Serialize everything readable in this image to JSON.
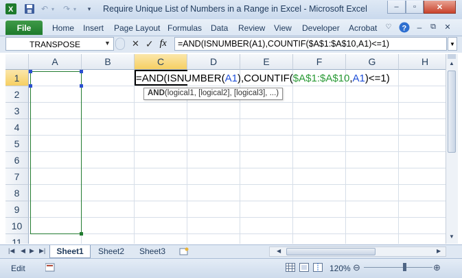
{
  "window": {
    "title": "Require Unique List of Numbers in a Range in Excel  -  Microsoft Excel",
    "controls": {
      "minimize": "–",
      "restore": "▫",
      "close": "✕"
    }
  },
  "quick_access": {
    "app_icon": "excel-logo-icon",
    "save_icon": "save-icon",
    "undo_icon": "undo-icon",
    "redo_icon": "redo-icon"
  },
  "ribbon": {
    "file_tab": "File",
    "tabs": [
      "Home",
      "Insert",
      "Page Layout",
      "Formulas",
      "Data",
      "Review",
      "View",
      "Developer",
      "Acrobat"
    ],
    "help_icon": "?"
  },
  "formula_bar": {
    "name_box": "TRANSPOSE",
    "cancel_icon": "✕",
    "enter_icon": "✓",
    "fx_label": "fx",
    "formula": "=AND(ISNUMBER(A1),COUNTIF($A$1:$A$10,A1)<=1)"
  },
  "grid": {
    "columns": [
      "A",
      "B",
      "C",
      "D",
      "E",
      "F",
      "G",
      "H"
    ],
    "active_column": "C",
    "rows": [
      "1",
      "2",
      "3",
      "4",
      "5",
      "6",
      "7",
      "8",
      "9",
      "10",
      "11"
    ],
    "active_row": "1",
    "edit_cell": {
      "address": "C1",
      "parts": [
        {
          "text": "=AND(ISNUMBER(",
          "color": "#000000"
        },
        {
          "text": "A1",
          "color": "#1f4fd8"
        },
        {
          "text": "),COUNTIF(",
          "color": "#000000"
        },
        {
          "text": "$A$1:$A$10",
          "color": "#2a9a36"
        },
        {
          "text": ",",
          "color": "#000000"
        },
        {
          "text": "A1",
          "color": "#1f4fd8"
        },
        {
          "text": ")<=1)",
          "color": "#000000"
        }
      ]
    },
    "tooltip": {
      "func": "AND",
      "args": "(logical1, [logical2], [logical3], ...)"
    }
  },
  "sheets": {
    "tabs": [
      "Sheet1",
      "Sheet2",
      "Sheet3"
    ],
    "active": "Sheet1"
  },
  "status": {
    "mode": "Edit",
    "zoom": "120%"
  },
  "colors": {
    "ref_blue": "#1f4fd8",
    "ref_green": "#2a9a36",
    "file_tab": "#1e7a2c",
    "active_header": "#f6cf62"
  }
}
